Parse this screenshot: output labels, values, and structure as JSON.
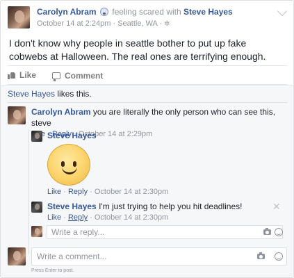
{
  "post": {
    "author": "Carolyn Abram",
    "feeling_text": "feeling scared with",
    "tagged": "Steve Hayes",
    "date": "October 14 at 2:24pm",
    "location": "Seattle, WA",
    "separator": "·",
    "text": "I don't know why people in seattle bother to put up fake cobwebs at Halloween. The real ones are terrifying enough."
  },
  "actions": {
    "like": "Like",
    "comment": "Comment"
  },
  "likes": {
    "name": "Steve Hayes",
    "suffix": "likes this."
  },
  "comments": [
    {
      "author": "Carolyn Abram",
      "text": "you are literally the only person who can see this, steve",
      "like": "Like",
      "reply": "Reply",
      "date": "October 14 at 2:29pm"
    }
  ],
  "replies": [
    {
      "author": "Steve Hayes",
      "sticker": "smiley-sticker",
      "like": "Like",
      "reply": "Reply",
      "date": "October 14 at 2:30pm"
    },
    {
      "author": "Steve Hayes",
      "text": "I'm just trying to help you hit deadlines!",
      "like": "Like",
      "reply": "Reply",
      "date": "October 14 at 2:30pm"
    }
  ],
  "reply_box": {
    "placeholder": "Write a reply..."
  },
  "comment_box": {
    "placeholder": "Write a comment...",
    "hint": "Press Enter to post."
  },
  "colors": {
    "link": "#365899",
    "meta": "#90949c",
    "background": "#f6f7f9"
  }
}
